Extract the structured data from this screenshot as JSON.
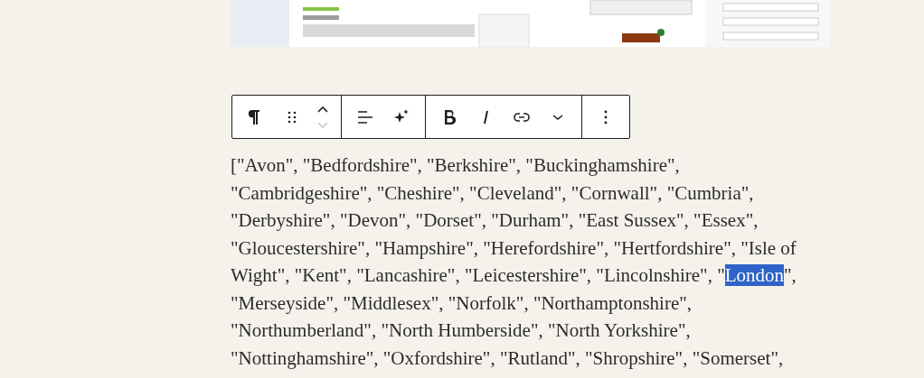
{
  "toolbar": {
    "groups": [
      [
        {
          "kind": "paragraph"
        },
        {
          "kind": "drag"
        },
        {
          "kind": "mover",
          "up_disabled": false,
          "down_disabled": true
        }
      ],
      [
        {
          "kind": "align"
        },
        {
          "kind": "sparkle"
        }
      ],
      [
        {
          "kind": "bold"
        },
        {
          "kind": "italic"
        },
        {
          "kind": "link"
        },
        {
          "kind": "more-rich"
        }
      ],
      [
        {
          "kind": "options"
        }
      ]
    ]
  },
  "paragraph": {
    "segments": [
      {
        "text": "[\"Avon\", \"Bedfordshire\", \"Berkshire\", \"Buckinghamshire\",\n\"Cambridgeshire\", \"Cheshire\", \"Cleveland\", \"Cornwall\", \"Cumbria\",\n\"Derbyshire\", \"Devon\", \"Dorset\", \"Durham\", \"East Sussex\", \"Essex\",\n\"Gloucestershire\", \"Hampshire\", \"Herefordshire\", \"Hertfordshire\", \"Isle of\nWight\", \"Kent\", \"Lancashire\", \"Leicestershire\", \"Lincolnshire\", \"",
        "selected": false
      },
      {
        "text": "London",
        "selected": true
      },
      {
        "text": "\",\n\"Merseyside\", \"Middlesex\", \"Norfolk\", \"Northamptonshire\",\n\"Northumberland\", \"North Humberside\", \"North Yorkshire\",\n\"Nottinghamshire\", \"Oxfordshire\", \"Rutland\", \"Shropshire\", \"Somerset\",",
        "selected": false
      }
    ]
  }
}
